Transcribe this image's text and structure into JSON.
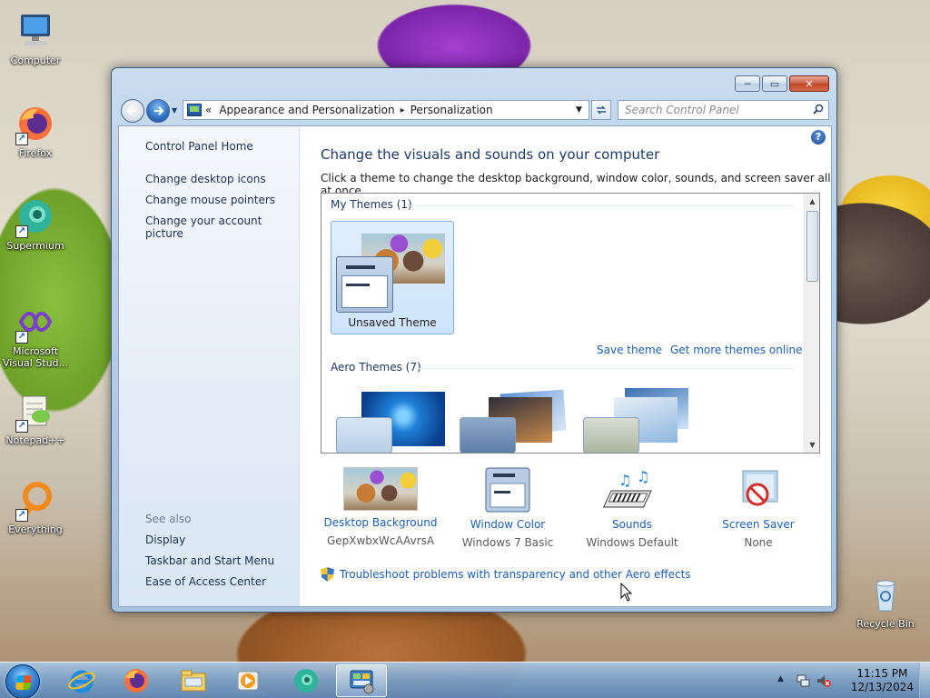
{
  "desktop": {
    "icons": [
      {
        "label": "Computer",
        "icon": "computer-icon"
      },
      {
        "label": "Firefox",
        "icon": "firefox-icon"
      },
      {
        "label": "Supermium",
        "icon": "supermium-icon"
      },
      {
        "label": "Microsoft Visual Stud...",
        "icon": "visual-studio-icon"
      },
      {
        "label": "Notepad++",
        "icon": "notepad-plus-plus-icon"
      },
      {
        "label": "Everything",
        "icon": "everything-icon"
      },
      {
        "label": "Recycle Bin",
        "icon": "recycle-bin-icon"
      }
    ]
  },
  "window": {
    "controls": {
      "minimize": "─",
      "maximize": "▭",
      "close": "✕"
    },
    "address": {
      "prefix": "«",
      "crumbs": [
        "Appearance and Personalization",
        "Personalization"
      ],
      "separator": "▸"
    },
    "search_placeholder": "Search Control Panel",
    "left_pane": {
      "home": "Control Panel Home",
      "links": [
        "Change desktop icons",
        "Change mouse pointers",
        "Change your account picture"
      ],
      "see_also_title": "See also",
      "see_also": [
        "Display",
        "Taskbar and Start Menu",
        "Ease of Access Center"
      ]
    },
    "main": {
      "heading": "Change the visuals and sounds on your computer",
      "subheading": "Click a theme to change the desktop background, window color, sounds, and screen saver all at once.",
      "my_themes_title": "My Themes (1)",
      "selected_theme": "Unsaved Theme",
      "save_theme": "Save theme",
      "get_more_themes": "Get more themes online",
      "aero_themes_title": "Aero Themes (7)",
      "bottom": [
        {
          "title": "Desktop Background",
          "value": "GepXwbxWcAAvrsA",
          "icon": "desktop-background-icon"
        },
        {
          "title": "Window Color",
          "value": "Windows 7 Basic",
          "icon": "window-color-icon"
        },
        {
          "title": "Sounds",
          "value": "Windows Default",
          "icon": "sounds-icon"
        },
        {
          "title": "Screen Saver",
          "value": "None",
          "icon": "screen-saver-icon"
        }
      ],
      "troubleshoot": "Troubleshoot problems with transparency and other Aero effects"
    }
  },
  "taskbar": {
    "pinned": [
      "internet-explorer-icon",
      "firefox-icon",
      "file-explorer-icon",
      "media-player-icon",
      "supermium-icon",
      "control-panel-icon"
    ],
    "time": "11:15 PM",
    "date": "12/13/2024"
  },
  "colors": {
    "link": "#1c5fb0",
    "heading": "#1e3a66",
    "selection_tile": "#cce4fb"
  }
}
